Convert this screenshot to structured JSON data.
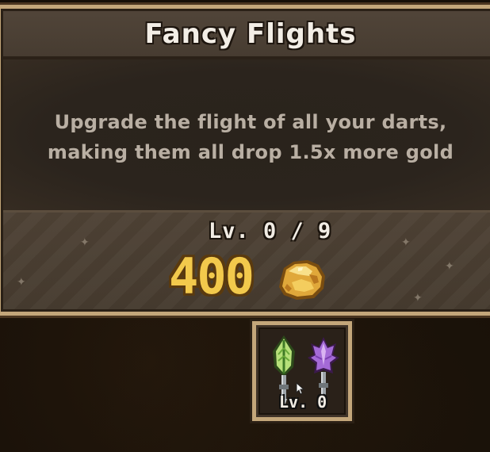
{
  "upgrade": {
    "title": "Fancy Flights",
    "description_lines": [
      "Upgrade the flight of all your darts,",
      "making them all drop 1.5x more gold"
    ],
    "level_text": "Lv. 0 / 9",
    "cost": "400",
    "currency_icon": "gold-nugget-icon"
  },
  "item_slot": {
    "level_text": "Lv. 0",
    "icons": [
      "green-leaf-dart-icon",
      "purple-flower-dart-icon"
    ]
  },
  "colors": {
    "frame": "#c3a67a",
    "gold_text": "#f2c94c",
    "title_text": "#f3eee6",
    "description_text": "#b9afa3"
  }
}
